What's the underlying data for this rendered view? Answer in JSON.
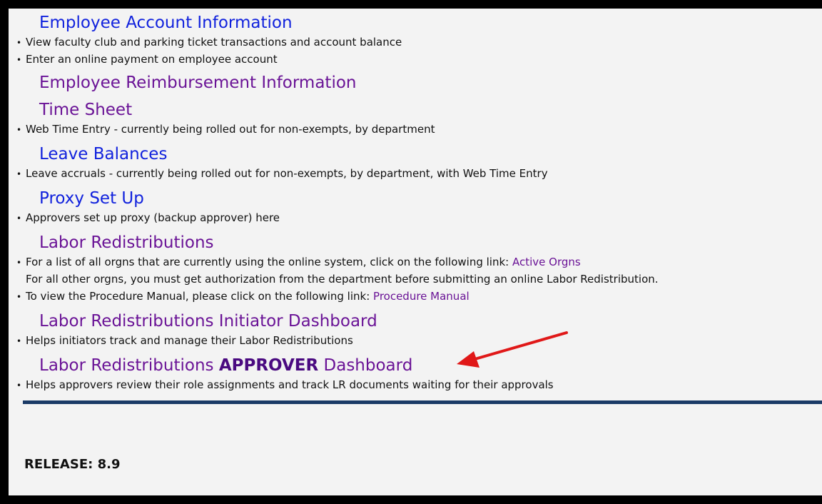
{
  "sections": {
    "employee_account": {
      "title": "Employee Account Information",
      "items": [
        "View faculty club and parking ticket transactions and account balance",
        "Enter an online payment on employee account"
      ]
    },
    "employee_reimbursement": {
      "title": "Employee Reimbursement Information"
    },
    "time_sheet": {
      "title": "Time Sheet",
      "items": [
        "Web Time Entry - currently being rolled out for non-exempts, by department"
      ]
    },
    "leave_balances": {
      "title": "Leave Balances",
      "items": [
        "Leave accruals - currently being rolled out for non-exempts, by department, with Web Time Entry"
      ]
    },
    "proxy_setup": {
      "title": "Proxy Set Up",
      "items": [
        "Approvers set up proxy (backup approver) here"
      ]
    },
    "labor_redistributions": {
      "title": "Labor Redistributions",
      "item1_text": "For a list of all orgns that are currently using the online system, click on the following link: ",
      "item1_link": "Active Orgns",
      "item1_cont": "For all other orgns, you must get authorization from the department before submitting an online Labor Redistribution.",
      "item2_text": "To view the Procedure Manual, please click on the following link: ",
      "item2_link": "Procedure Manual"
    },
    "initiator_dashboard": {
      "title": "Labor Redistributions Initiator Dashboard",
      "items": [
        "Helps initiators track and manage their Labor Redistributions"
      ]
    },
    "approver_dashboard": {
      "title_prefix": "Labor Redistributions ",
      "title_bold": "APPROVER",
      "title_suffix": " Dashboard",
      "items": [
        "Helps approvers review their role assignments and track LR documents waiting for their approvals"
      ]
    }
  },
  "bullet": "•",
  "release": "RELEASE: 8.9",
  "colors": {
    "link_blue": "#1122dd",
    "link_purple": "#6a1396",
    "rule": "#1a3a66",
    "arrow": "#e01818"
  },
  "annotation": {
    "icon": "red-arrow-icon"
  }
}
